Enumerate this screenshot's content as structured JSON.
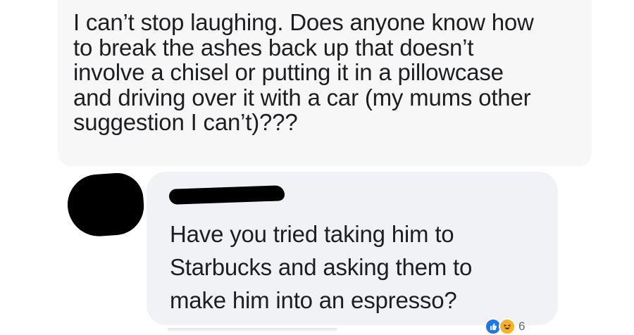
{
  "post": {
    "lines": [
      "I can’t stop laughing. Does anyone know how",
      "to break the ashes back up that doesn’t",
      "involve a chisel or putting it in a pillowcase",
      "and driving over it with a car (my mums other",
      "suggestion I can’t)???"
    ]
  },
  "comment": {
    "lines": [
      "Have you tried taking him to",
      "Starbucks and asking them to",
      "make him into an espresso?"
    ]
  },
  "reactions": {
    "icons": [
      "like-icon",
      "haha-icon"
    ],
    "count": "6",
    "colors": {
      "like": "#1877f2",
      "haha": "#f7b125"
    }
  },
  "colors": {
    "comment_bubble": "#f0f2f5",
    "post_background": "#f7f7f8",
    "text": "#1c1e21"
  }
}
